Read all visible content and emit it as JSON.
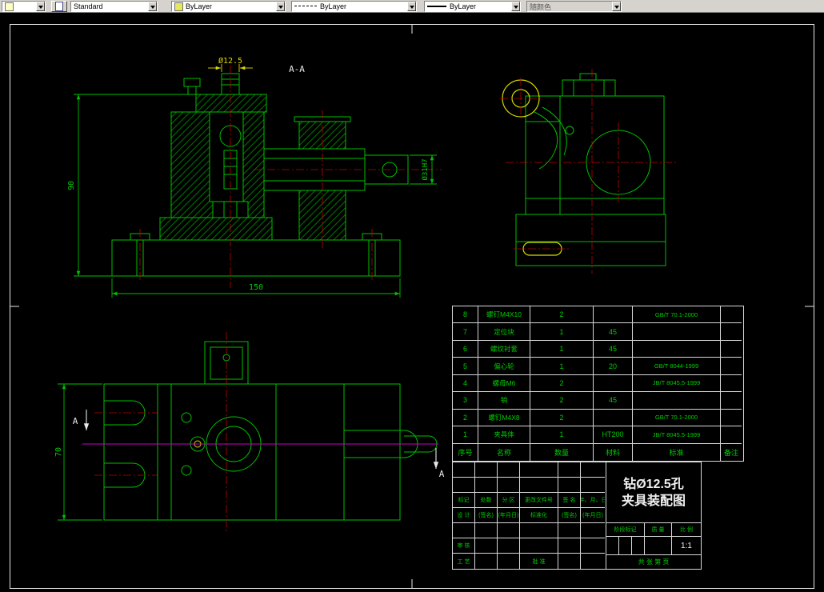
{
  "toolbar": {
    "text_style": "Standard",
    "color": "ByLayer",
    "linetype": "ByLayer",
    "lineweight": "ByLayer",
    "plot_style": "随颜色"
  },
  "drawing": {
    "section_label": "A-A",
    "section_letter": "A",
    "dim_height": "90",
    "dim_width": "150",
    "dim_hole": "Ø12.5",
    "dim_bore": "Ø31H7",
    "dim_top_height": "70"
  },
  "bom": {
    "headers": {
      "seq": "序号",
      "name": "名称",
      "qty": "数量",
      "material": "材料",
      "standard": "标准",
      "note": "备注"
    },
    "rows": [
      {
        "seq": "8",
        "name": "螺钉M4X10",
        "qty": "2",
        "material": "",
        "standard": "GB/T 70.1-2000",
        "note": ""
      },
      {
        "seq": "7",
        "name": "定位块",
        "qty": "1",
        "material": "45",
        "standard": "",
        "note": ""
      },
      {
        "seq": "6",
        "name": "螺纹衬套",
        "qty": "1",
        "material": "45",
        "standard": "",
        "note": ""
      },
      {
        "seq": "5",
        "name": "偏心轮",
        "qty": "1",
        "material": "20",
        "standard": "GB/T 8044-1999",
        "note": ""
      },
      {
        "seq": "4",
        "name": "螺母M6",
        "qty": "2",
        "material": "",
        "standard": "JB/T 8045.5-1999",
        "note": ""
      },
      {
        "seq": "3",
        "name": "销",
        "qty": "2",
        "material": "45",
        "standard": "",
        "note": ""
      },
      {
        "seq": "2",
        "name": "螺钉M4X8",
        "qty": "2",
        "material": "",
        "standard": "GB/T 70.1-2000",
        "note": ""
      },
      {
        "seq": "1",
        "name": "夹具体",
        "qty": "1",
        "material": "HT200",
        "standard": "JB/T 8045.5-1999",
        "note": ""
      }
    ]
  },
  "titleblock": {
    "title_line1": "钻Ø12.5孔",
    "title_line2": "夹具装配图",
    "row1": [
      "标记",
      "处数",
      "分 区",
      "更改文件号",
      "签 名",
      "年、月、日"
    ],
    "row2": [
      "设 计",
      "(签名)",
      "(年月日)",
      "标准化",
      "(签名)",
      "(年月日)"
    ],
    "shenhe": "审 核",
    "gongyi": "工 艺",
    "pizhun": "批 准",
    "stage": "阶段标记",
    "mass": "质 量",
    "scale_label": "比 例",
    "scale_value": "1:1",
    "sheet_info": "共  张  第  页"
  }
}
